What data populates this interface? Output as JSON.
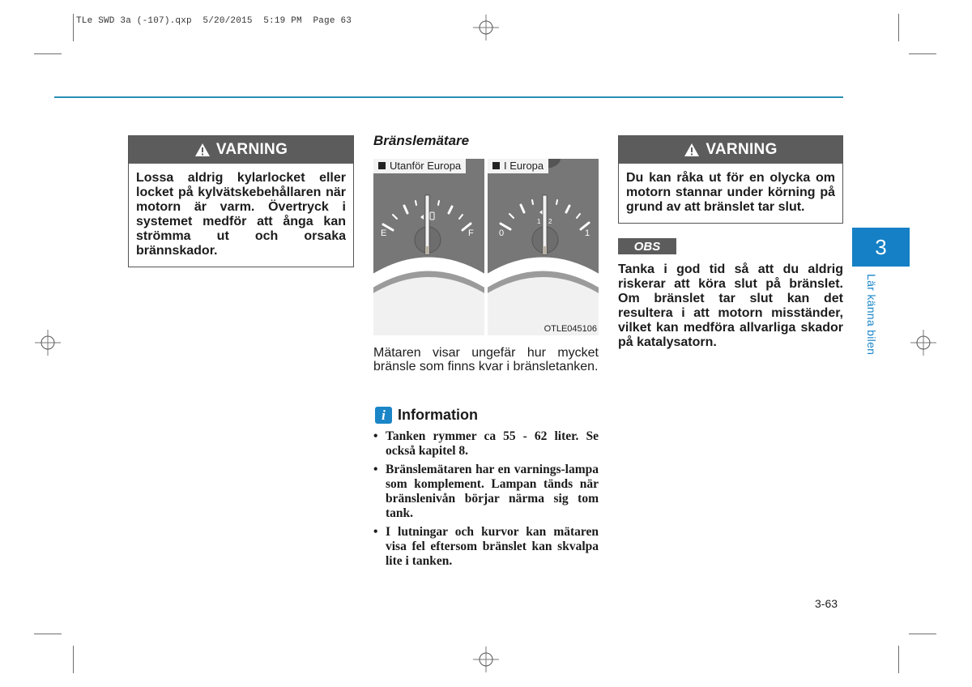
{
  "print_slug": "TLe SWD 3a (-107).qxp  5/20/2015  5:19 PM  Page 63",
  "left_warning": {
    "title": "VARNING",
    "icon": "warning-triangle-icon",
    "text": "Lossa aldrig kylarlocket eller locket på kylvätskebehållaren när motorn är varm. Övertryck i systemet medför att ånga kan strömma ut och orsaka brännskador."
  },
  "fuel_gauge_section": {
    "title": "Bränslemätare",
    "figure": {
      "panels": [
        {
          "label": "Utanför Europa",
          "scale_left": "E",
          "scale_right": "F"
        },
        {
          "label": "I Europa",
          "scale_left": "0",
          "scale_right": "1",
          "scale_mid": "1/2"
        }
      ],
      "figure_code": "OTLE045106"
    },
    "description": "Mätaren visar ungefär hur mycket bränsle som finns kvar i bränsletanken.",
    "information": {
      "icon": "info-icon",
      "icon_glyph": "i",
      "title": "Information",
      "bullets": [
        "Tanken rymmer ca 55 - 62 liter. Se också kapitel 8.",
        "Bränslemätaren har en varnings-lampa som komplement. Lampan tänds när bränslenivån börjar närma sig tom tank.",
        "I lutningar och kurvor kan mätaren visa fel eftersom bränslet kan skvalpa lite i tanken."
      ]
    }
  },
  "right_warning": {
    "title": "VARNING",
    "icon": "warning-triangle-icon",
    "text": "Du kan råka ut för en olycka om motorn stannar under körning på grund av att bränslet tar slut."
  },
  "obs": {
    "label": "OBS",
    "text": "Tanka i god tid så att du aldrig riskerar att köra slut på bränslet. Om bränslet tar slut kan det resultera i att motorn misständer, vilket kan medföra allvarliga skador på katalysatorn."
  },
  "chapter": {
    "number": "3",
    "title": "Lär känna bilen"
  },
  "page_number": "3-63",
  "colors": {
    "accent": "#1580c5",
    "rule": "#2a8fb5",
    "warning_header": "#5c5c5c"
  }
}
